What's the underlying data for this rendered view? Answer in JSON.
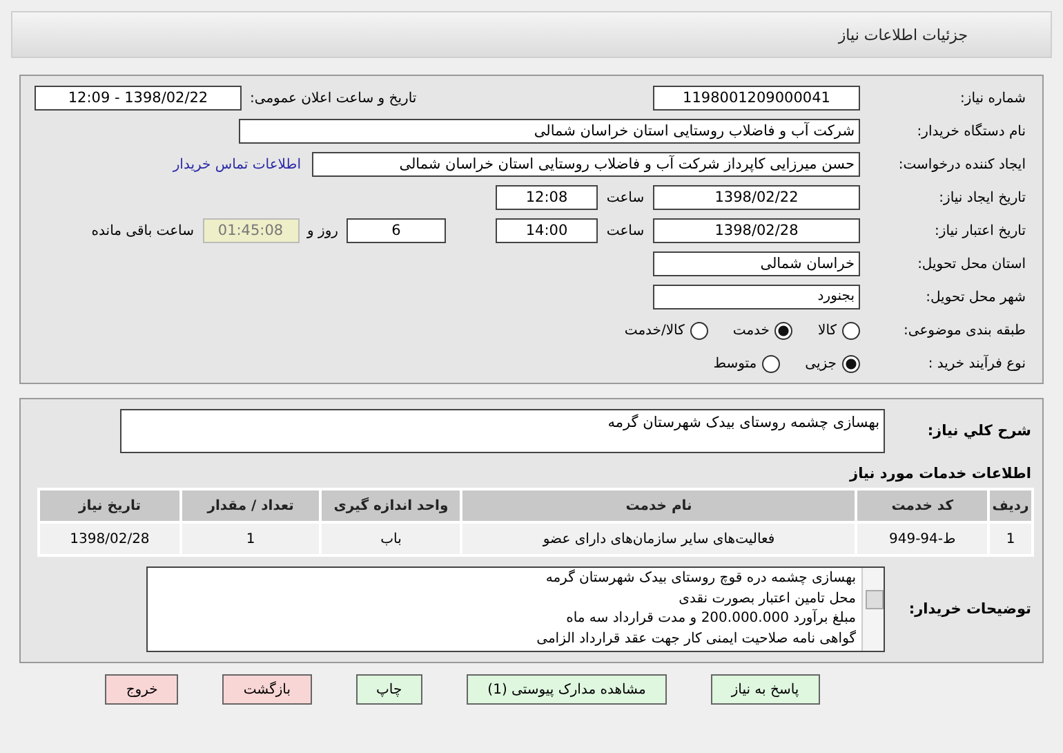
{
  "header": {
    "title": "جزئیات اطلاعات نیاز"
  },
  "need_number": {
    "label": "شماره نیاز:",
    "value": "1198001209000041"
  },
  "announce": {
    "label": "تاریخ و ساعت اعلان عمومی:",
    "value": "1398/02/22 - 12:09"
  },
  "buyer_org": {
    "label": "نام دستگاه خریدار:",
    "value": "شرکت آب و فاضلاب روستایی استان خراسان شمالی"
  },
  "requester": {
    "label": "ایجاد کننده درخواست:",
    "value": "حسن  میرزایی کاپرداز شرکت آب و فاضلاب روستایی استان خراسان شمالی",
    "link": "اطلاعات تماس خریدار"
  },
  "created": {
    "label": "تاریخ ایجاد نیاز:",
    "date": "1398/02/22",
    "time_label": "ساعت",
    "time": "12:08"
  },
  "validity": {
    "label": "تاریخ اعتبار نیاز:",
    "date": "1398/02/28",
    "time_label": "ساعت",
    "time": "14:00",
    "days": "6",
    "days_label": "روز و",
    "remaining": "01:45:08",
    "remaining_label": "ساعت باقی مانده"
  },
  "province": {
    "label": "استان محل تحویل:",
    "value": "خراسان شمالی"
  },
  "city": {
    "label": "شهر محل تحویل:",
    "value": "بجنورد"
  },
  "category": {
    "label": "طبقه بندی موضوعی:",
    "options": [
      {
        "label": "کالا",
        "selected": false
      },
      {
        "label": "خدمت",
        "selected": true
      },
      {
        "label": "کالا/خدمت",
        "selected": false
      }
    ]
  },
  "process": {
    "label": "نوع فرآیند خرید :",
    "options": [
      {
        "label": "جزیی",
        "selected": true
      },
      {
        "label": "متوسط",
        "selected": false
      }
    ]
  },
  "summary": {
    "label": "شرح کلي نياز:",
    "value": "بهسازی چشمه روستای بیدک شهرستان گرمه"
  },
  "services": {
    "title": "اطلاعات خدمات مورد نیاز",
    "columns": [
      "ردیف",
      "کد خدمت",
      "نام خدمت",
      "واحد اندازه گیری",
      "تعداد / مقدار",
      "تاریخ نیاز"
    ],
    "rows": [
      [
        "1",
        "ط-94-949",
        "فعالیت‌های سایر سازمان‌های دارای عضو",
        "باب",
        "1",
        "1398/02/28"
      ]
    ]
  },
  "notes": {
    "label": "توضیحات خریدار:",
    "lines": [
      "بهسازی چشمه دره قوچ روستای بیدک شهرستان گرمه",
      "محل تامین اعتبار بصورت نقدی",
      "مبلغ برآورد 200.000.000 و مدت قرارداد سه ماه",
      "گواهی نامه صلاحیت ایمنی کار جهت عقد قرارداد الزامی"
    ]
  },
  "buttons": [
    {
      "label": "پاسخ به نیاز",
      "kind": "primary"
    },
    {
      "label": "مشاهده مدارک پیوستی (1)",
      "kind": "primary"
    },
    {
      "label": "چاپ",
      "kind": "primary"
    },
    {
      "label": "بازگشت",
      "kind": "danger"
    },
    {
      "label": "خروج",
      "kind": "danger"
    }
  ]
}
